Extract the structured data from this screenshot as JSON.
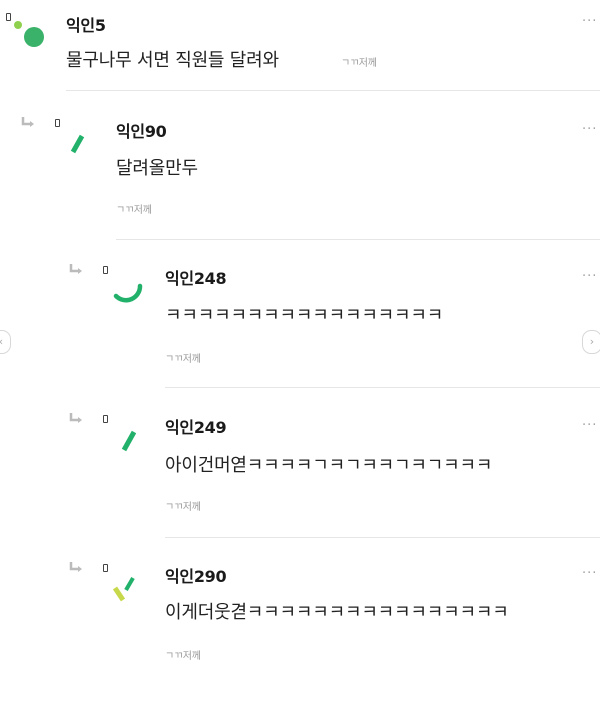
{
  "comments": [
    {
      "author": "익인5",
      "text": "물구나무 서면 직원들 달려와",
      "meta": "ㄱㄲ저께",
      "more": "···"
    },
    {
      "author": "익인90",
      "text": "달려올만두",
      "meta": "ㄱㄲ저께",
      "more": "···"
    },
    {
      "author": "익인248",
      "text": "ㅋㅋㅋㅋㅋㅋㅋㅋㅋㅋㅋㅋㅋㅋㅋㅋㅋ",
      "meta": "ㄱㄲ저께",
      "more": "···"
    },
    {
      "author": "익인249",
      "text": "아이건머엳ㅋㅋㅋㅋㄱㅋㄱㅋㅋㄱㅋㄱㅋㅋㅋ",
      "meta": "ㄱㄲ저께",
      "more": "···"
    },
    {
      "author": "익인290",
      "text": "이게더웃겯ㅋㅋㅋㅋㅋㅋㅋㅋㅋㅋㅋㅋㅋㅋㅋㅋ",
      "meta": "ㄱㄲ저께",
      "more": "···"
    }
  ],
  "nav": {
    "prev": "‹",
    "next": "›"
  },
  "colors": {
    "accent_green": "#21b16a",
    "light_green": "#8fd14f",
    "yellow_green": "#c7d94a"
  }
}
